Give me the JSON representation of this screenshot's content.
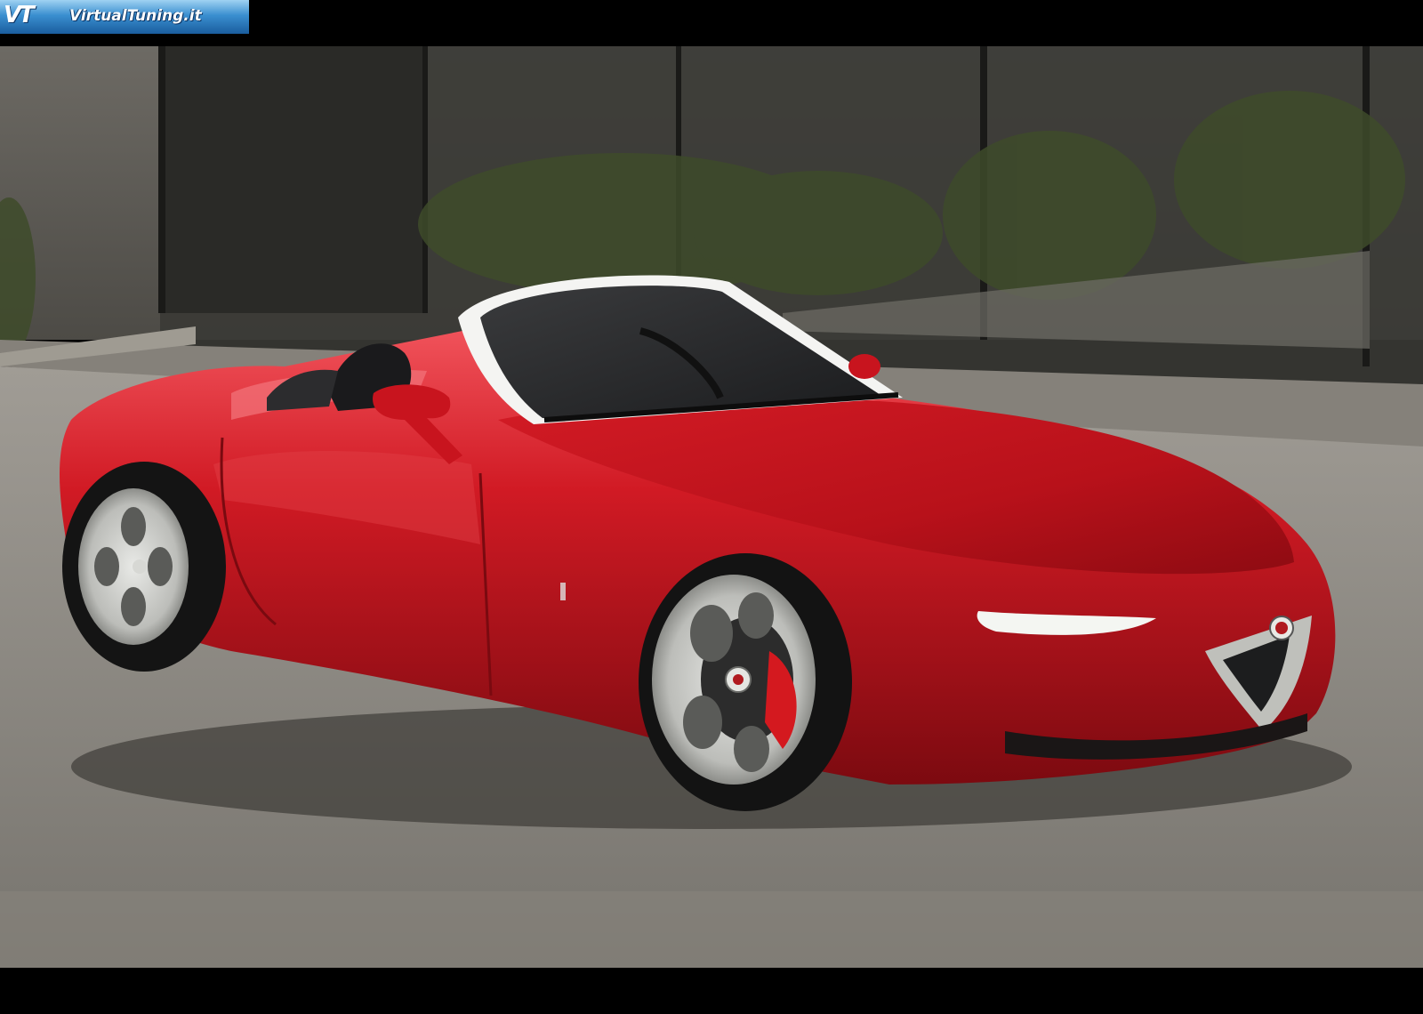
{
  "logo": {
    "mark": "VT",
    "text": "VirtualTuning.it"
  },
  "colors": {
    "body_red": "#c4121c",
    "wall_gray": "#5e5c57",
    "glass_dark": "#2c2d2a",
    "hedge_green": "#3e4b2a",
    "asphalt": "#8e8a82",
    "headlight": "#f4f6f2",
    "wheel_silver": "#cfd0cc"
  },
  "icons": {
    "logo": "virtualtuning-logo-icon",
    "badge": "alfa-romeo-badge-icon"
  }
}
